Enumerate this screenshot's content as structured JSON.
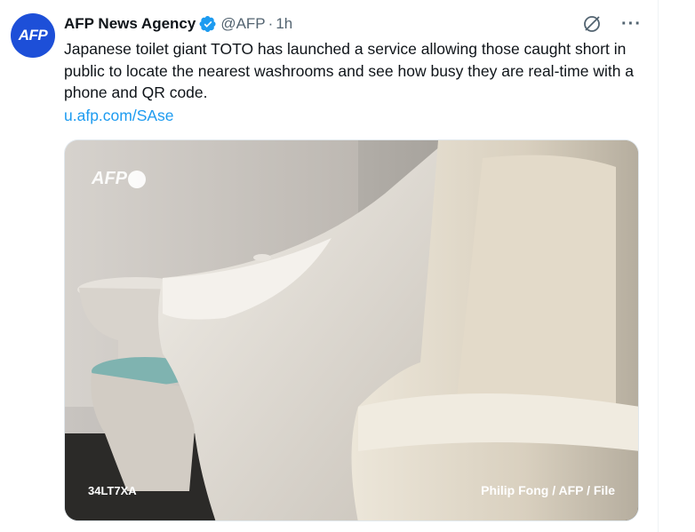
{
  "tweet": {
    "avatar_text": "AFP",
    "display_name": "AFP News Agency",
    "handle": "@AFP",
    "separator": "·",
    "time": "1h",
    "text": "Japanese toilet giant TOTO has launched a service allowing those caught short in public to locate the nearest washrooms and see how busy they are real-time with a phone and QR code.",
    "link": "u.afp.com/SAse",
    "more_label": "···"
  },
  "media": {
    "watermark": "AFP",
    "photo_id": "34LT7XA",
    "credit": "Philip Fong / AFP / File"
  },
  "icons": {
    "verified": "verified-badge-icon",
    "grok": "grok-icon",
    "more": "more-icon"
  },
  "colors": {
    "link": "#1d9bf0",
    "verified": "#1d9bf0",
    "avatar": "#1d4fd8",
    "secondary_text": "#536471",
    "seat_lid": "#7fb3b0"
  }
}
